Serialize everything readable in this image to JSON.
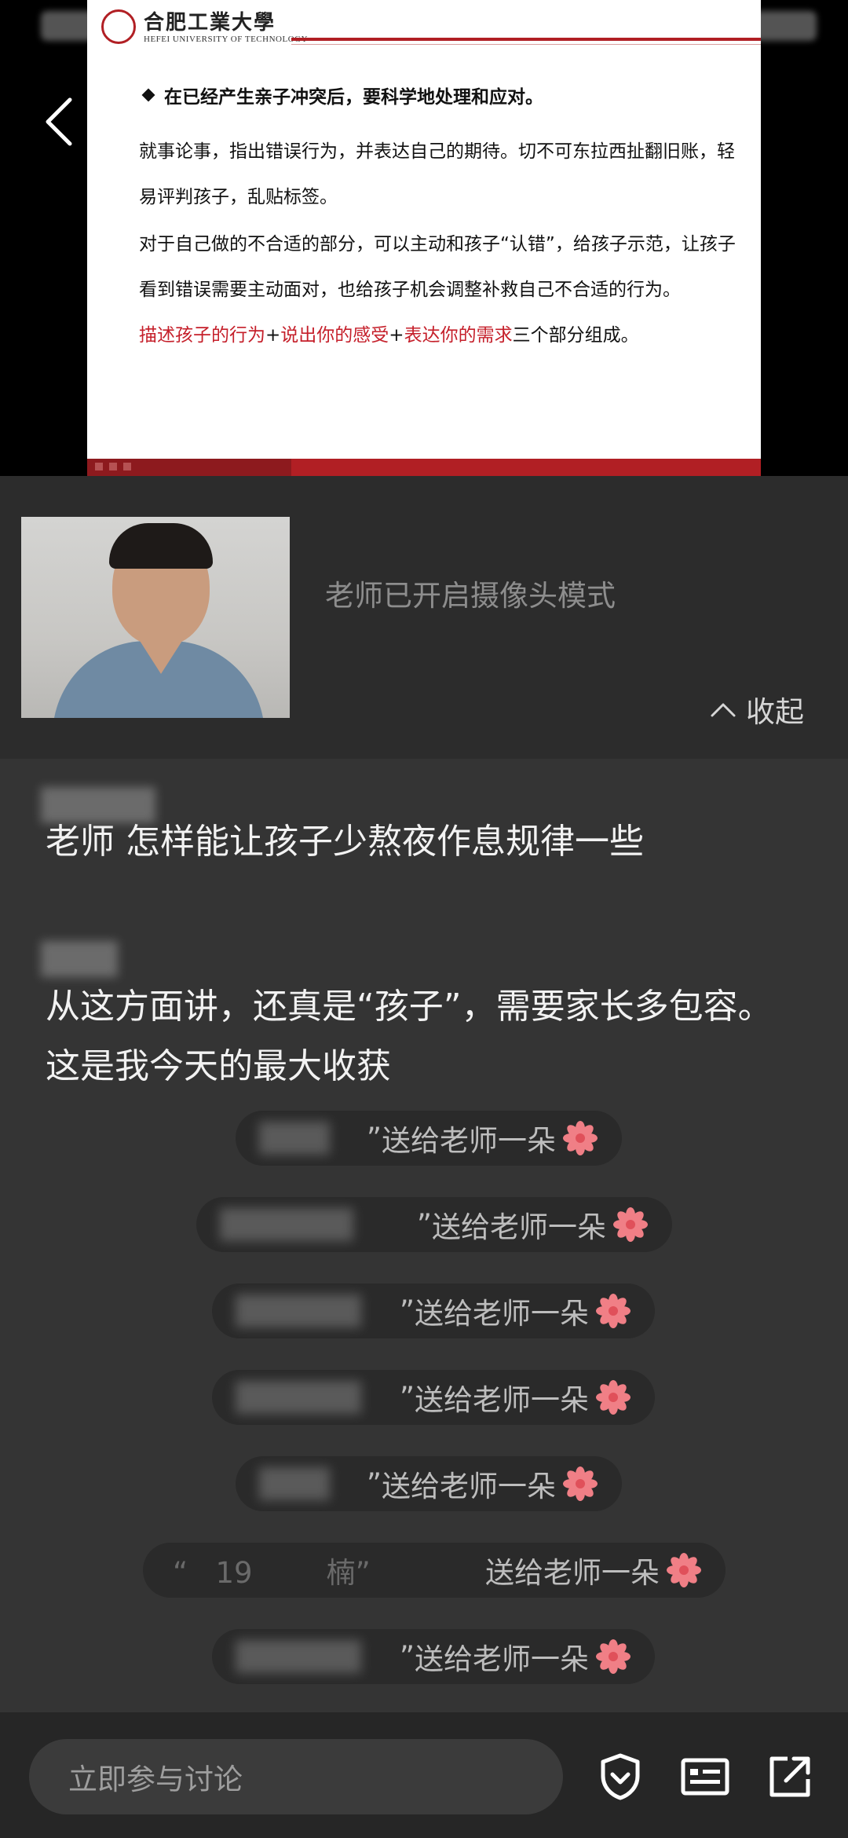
{
  "slide": {
    "university_cn": "合肥工業大學",
    "university_en": "HEFEI UNIVERSITY OF TECHNOLOGY",
    "heading": "在已经产生亲子冲突后，要科学地处理和应对。",
    "paragraph1": "就事论事，指出错误行为，并表达自己的期待。切不可东拉西扯翻旧账，轻易评判孩子，乱贴标签。",
    "paragraph2": "对于自己做的不合适的部分，可以主动和孩子“认错”，给孩子示范，让孩子看到错误需要主动面对，也给孩子机会调整补救自己不合适的行为。",
    "formula": {
      "part1": "描述孩子的行为",
      "plus": "+",
      "part2": "说出你的感受",
      "part3": "表达你的需求",
      "suffix": "三个部分组成。"
    }
  },
  "camera": {
    "notice": "老师已开启摄像头模式",
    "collapse_label": "收起"
  },
  "chat": {
    "messages": [
      {
        "text": "老师 怎样能让孩子少熬夜作息规律一些"
      },
      {
        "text": "从这方面讲，还真是“孩子”，需要家长多包容。这是我今天的最大收获"
      }
    ],
    "gift_text": "送给老师一朵",
    "gifts": [
      {
        "prefix": "”"
      },
      {
        "prefix": "”"
      },
      {
        "prefix": "”"
      },
      {
        "prefix": "”"
      },
      {
        "prefix": "”"
      },
      {
        "prefix": "“   19        楠”"
      },
      {
        "prefix": "”"
      }
    ]
  },
  "bottom": {
    "input_placeholder": "立即参与讨论",
    "icons": [
      "shield-icon",
      "id-card-icon",
      "share-external-icon"
    ]
  },
  "colors": {
    "accent_red": "#c51f2a",
    "header_red": "#b11f24",
    "flower": "#f07f86"
  }
}
